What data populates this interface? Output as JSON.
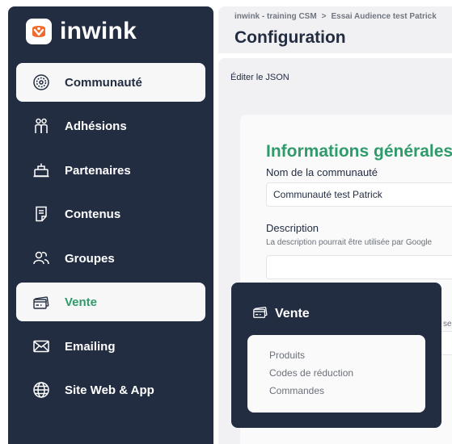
{
  "brand": {
    "name": "inwink"
  },
  "sidebar": {
    "items": [
      {
        "label": "Communauté",
        "icon": "community-icon",
        "state": "active"
      },
      {
        "label": "Adhésions",
        "icon": "members-icon"
      },
      {
        "label": "Partenaires",
        "icon": "partners-icon"
      },
      {
        "label": "Contenus",
        "icon": "document-icon"
      },
      {
        "label": "Groupes",
        "icon": "groups-icon"
      },
      {
        "label": "Vente",
        "icon": "sale-icon",
        "state": "hover"
      },
      {
        "label": "Emailing",
        "icon": "mail-icon"
      },
      {
        "label": "Site Web & App",
        "icon": "globe-icon"
      }
    ]
  },
  "header": {
    "breadcrumb": [
      "inwink - training CSM",
      "Essai Audience test Patrick"
    ],
    "breadcrumb_sep": ">",
    "title": "Configuration"
  },
  "main": {
    "edit_json_label": "Éditer le JSON",
    "section_title": "Informations générales",
    "name_label": "Nom de la communauté",
    "name_value": "Communauté test Patrick",
    "description_label": "Description",
    "description_help": "La description pourrait être utilisée par Google",
    "description_value": "",
    "cut_text": "sen"
  },
  "flyout": {
    "title": "Vente",
    "icon": "sale-icon",
    "links": [
      "Produits",
      "Codes de réduction",
      "Commandes"
    ]
  },
  "colors": {
    "sidebar_bg": "#232d42",
    "accent_green": "#2f9a6a",
    "brand_orange": "#f26a2e",
    "panel_bg": "#f1f1f3"
  }
}
